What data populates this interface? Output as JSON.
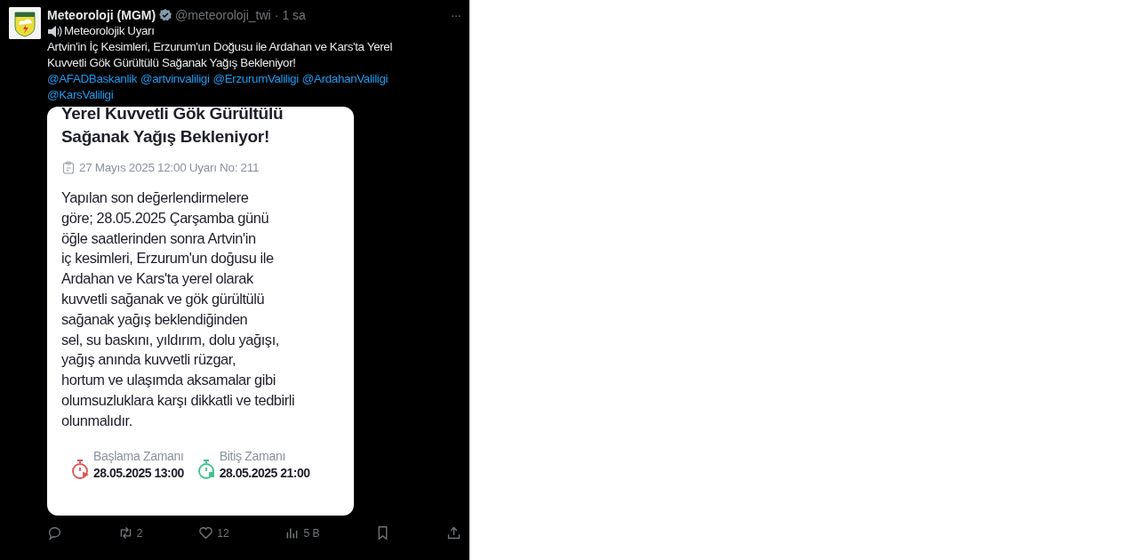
{
  "post": {
    "author": "Meteoroloji (MGM)",
    "verified": true,
    "handle": "@meteoroloji_twi",
    "separator": "·",
    "time": "1 sa",
    "more": "···",
    "text_lines": [
      "Meteorolojik Uyarı",
      "Artvin'in İç Kesimleri, Erzurum'un Doğusu ile Ardahan ve Kars'ta Yerel Kuvvetli Gök Gürültülü Sağanak Yağış Bekleniyor!"
    ],
    "mentions": [
      "@AFADBaskanlik",
      "@artvinvaliligi",
      "@ErzurumValiligi",
      "@ArdahanValiligi",
      "@KarsValiligi"
    ]
  },
  "card": {
    "title_lines": [
      "Yerel Kuvvetli Gök Gürültülü",
      "Sağanak Yağış Bekleniyor!"
    ],
    "meta": "27 Mayıs 2025 12:00 Uyarı No: 211",
    "body_lines": [
      "Yapılan son değerlendirmelere",
      "göre; 28.05.2025 Çarşamba günü",
      "öğle saatlerinden sonra Artvin'in",
      "iç kesimleri, Erzurum'un doğusu ile",
      "Ardahan ve Kars'ta yerel olarak",
      "kuvvetli sağanak ve gök gürültülü",
      "sağanak yağış beklendiğinden",
      "sel, su baskını, yıldırım, dolu yağışı,",
      "yağış anında kuvvetli rüzgar,",
      "hortum ve ulaşımda aksamalar gibi",
      "olumsuzluklara karşı dikkatli ve tedbirli",
      "olunmalıdır."
    ],
    "times": [
      {
        "kind": "start",
        "label": "Başlama Zamanı",
        "value": "28.05.2025 13:00",
        "color": "#e05252"
      },
      {
        "kind": "end",
        "label": "Bitiş Zamanı",
        "value": "28.05.2025 21:00",
        "color": "#3cc08a"
      }
    ]
  },
  "actions": [
    {
      "kind": "reply"
    },
    {
      "kind": "repost",
      "count": "2"
    },
    {
      "kind": "like",
      "count": "12"
    },
    {
      "kind": "views",
      "count": "5 B"
    },
    {
      "kind": "bookmark"
    },
    {
      "kind": "share"
    }
  ]
}
